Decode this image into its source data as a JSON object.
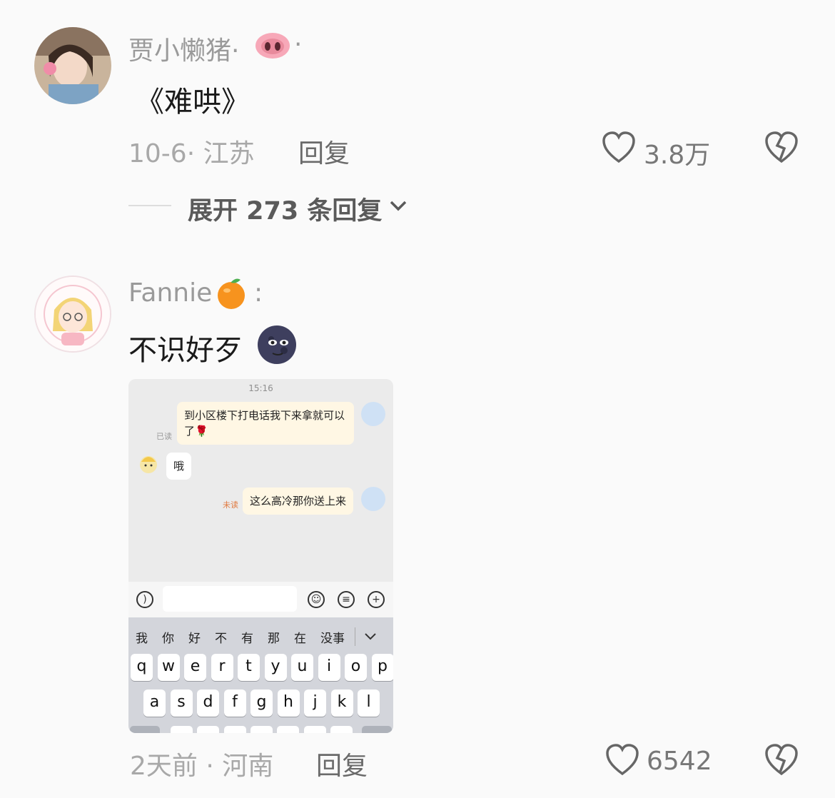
{
  "comments": [
    {
      "username": "贾小懒猪",
      "separator_left": "·",
      "separator_right": "·",
      "text": "《难哄》",
      "date": "10-6",
      "location": "江苏",
      "meta_separator": "·",
      "reply_label": "回复",
      "likes": "3.8万",
      "expand_label": "展开 273 条回复"
    },
    {
      "username": "Fannie",
      "colon": ":",
      "text": "不识好歹",
      "date": "2天前",
      "location": "河南",
      "meta_separator": "·",
      "reply_label": "回复",
      "likes": "6542"
    }
  ],
  "chat_screenshot": {
    "time": "15:16",
    "messages": [
      {
        "side": "right",
        "text": "到小区楼下打电话我下来拿就可以了🌹",
        "status": "已读"
      },
      {
        "side": "left",
        "text": "哦"
      },
      {
        "side": "right",
        "text": "这么高冷那你送上来",
        "status": "未读"
      }
    ],
    "candidates": [
      "我",
      "你",
      "好",
      "不",
      "有",
      "那",
      "在",
      "没事"
    ],
    "keyboard_row1": [
      "q",
      "w",
      "e",
      "r",
      "t",
      "y",
      "u",
      "i",
      "o",
      "p"
    ],
    "keyboard_row2": [
      "a",
      "s",
      "d",
      "f",
      "g",
      "h",
      "j",
      "k",
      "l"
    ]
  },
  "colors": {
    "background": "#fafafa",
    "username": "#9a9a9a",
    "meta": "#a8a8a8",
    "chat_bubble_self": "#fff7e4",
    "unread": "#e07a40"
  },
  "icons": [
    "pig-emoji-icon",
    "heart-icon",
    "broken-heart-icon",
    "chevron-down-icon",
    "orange-emoji-icon",
    "moon-face-emoji-icon",
    "voice-icon",
    "emoji-icon",
    "list-icon",
    "plus-icon"
  ]
}
